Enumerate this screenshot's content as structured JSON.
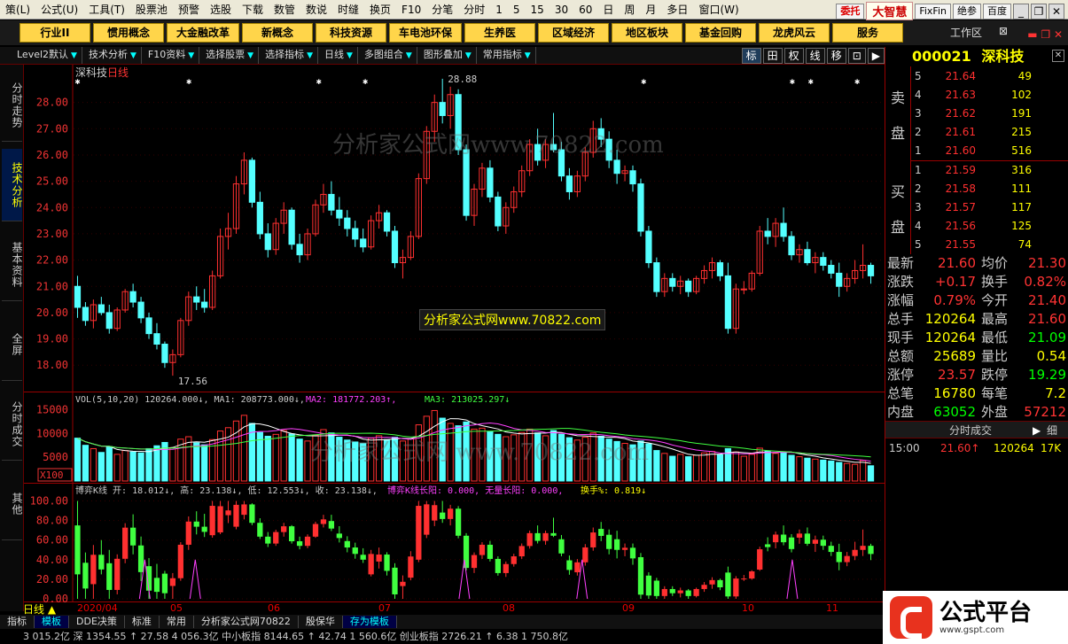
{
  "menu": [
    "策(L)",
    "公式(U)",
    "工具(T)",
    "股票池",
    "预警",
    "选股",
    "下载",
    "数管",
    "数说",
    "时缝",
    "换页",
    "F10",
    "分笔",
    "分时",
    "1",
    "5",
    "15",
    "30",
    "60",
    "日",
    "周",
    "月",
    "多日",
    "窗口(W)"
  ],
  "menu_right": {
    "btn1": "委托",
    "brand": "大智慧",
    "btn2": "FixFin",
    "btn3": "绝参",
    "btn4": "百度"
  },
  "topbar": [
    "行业II",
    "惯用概念",
    "大金融改革",
    "新概念",
    "科技资源",
    "车电池环保",
    "生养医",
    "区域经济",
    "地区板块",
    "基金回购",
    "龙虎风云",
    "服务"
  ],
  "workarea": "工作区",
  "subbar": {
    "items": [
      "Level2默认",
      "技术分析",
      "F10资料",
      "选择股票",
      "选择指标",
      "日线",
      "多图组合",
      "图形叠加",
      "常用指标"
    ],
    "right": [
      "标",
      "田",
      "权",
      "线",
      "移",
      "⊡",
      "▶"
    ]
  },
  "lefttabs": [
    "分时走势",
    "技术分析",
    "基本资料",
    "全屏",
    "分时成交",
    "其他"
  ],
  "main": {
    "title": "深科技",
    "period": "日线",
    "yaxis": [
      "28.00",
      "27.00",
      "26.00",
      "25.00",
      "24.00",
      "23.00",
      "22.00",
      "21.00",
      "20.00",
      "19.00",
      "18.00"
    ],
    "high_label": "28.88",
    "low_label": "17.56"
  },
  "vol": {
    "legend": "VOL(5,10,20)  120264.000↓, MA1: 208773.000↓,",
    "ma2": "MA2: 181772.203↑,",
    "ma3": "MA3: 213025.297↓",
    "yaxis": [
      "15000",
      "10000",
      "5000"
    ],
    "unit": "X100"
  },
  "ind": {
    "legend": "博弈K线 开: 18.012↓, 高: 23.138↓, 低: 12.553↓, 收: 23.138↓,",
    "legend2": "博弈K线长阳: 0.000, 无量长阳: 0.000,",
    "legend3": "换手%: 0.819↓",
    "yaxis": [
      "100.00",
      "80.00",
      "60.00",
      "40.00",
      "20.00",
      "0.00"
    ]
  },
  "dates": [
    "2020/04",
    "05",
    "06",
    "07",
    "08",
    "09",
    "10",
    "11"
  ],
  "kind": "日线",
  "bottomtabs": [
    "指标",
    "模板",
    "DDE决策",
    "标准",
    "常用",
    "分析家公式网70822",
    "殷保华",
    "存为模板"
  ],
  "ticker": "3 015.2亿  深  1354.55  ↑ 27.58  4 056.3亿  中小板指  8144.65  ↑ 42.74  1 560.6亿  创业板指  2726.21  ↑ 6.38  1 750.8亿",
  "stock": {
    "code": "000021",
    "name": "深科技"
  },
  "asks": [
    {
      "i": "5",
      "p": "21.64",
      "v": "49"
    },
    {
      "i": "4",
      "p": "21.63",
      "v": "102"
    },
    {
      "i": "3",
      "p": "21.62",
      "v": "191"
    },
    {
      "i": "2",
      "p": "21.61",
      "v": "215"
    },
    {
      "i": "1",
      "p": "21.60",
      "v": "516"
    }
  ],
  "bids": [
    {
      "i": "1",
      "p": "21.59",
      "v": "316"
    },
    {
      "i": "2",
      "p": "21.58",
      "v": "111"
    },
    {
      "i": "3",
      "p": "21.57",
      "v": "117"
    },
    {
      "i": "4",
      "p": "21.56",
      "v": "125"
    },
    {
      "i": "5",
      "p": "21.55",
      "v": "74"
    }
  ],
  "sides": {
    "sell1": "卖",
    "sell2": "盘",
    "buy1": "买",
    "buy2": "盘"
  },
  "stats": [
    {
      "l": "最新",
      "v": "21.60",
      "l2": "均价",
      "v2": "21.30"
    },
    {
      "l": "涨跌",
      "v": "+0.17",
      "l2": "换手",
      "v2": "0.82%"
    },
    {
      "l": "涨幅",
      "v": "0.79%",
      "l2": "今开",
      "v2": "21.40"
    },
    {
      "l": "总手",
      "v": "120264",
      "l2": "最高",
      "v2": "21.60"
    },
    {
      "l": "现手",
      "v": "120264",
      "l2": "最低",
      "v2": "21.09"
    },
    {
      "l": "总额",
      "v": "25689",
      "l2": "量比",
      "v2": "0.54"
    },
    {
      "l": "涨停",
      "v": "23.57",
      "l2": "跌停",
      "v2": "19.29"
    },
    {
      "l": "总笔",
      "v": "16780",
      "l2": "每笔",
      "v2": "7.2"
    },
    {
      "l": "内盘",
      "v": "63052",
      "l2": "外盘",
      "v2": "57212"
    }
  ],
  "fs": {
    "title": "分时成交",
    "btn": "细",
    "time": "15:00",
    "price": "21.60↑",
    "vol": "120264",
    "extra": "17K"
  },
  "watermarks": {
    "w1": "分析家公式网www.70822.com",
    "w2": "分析家公式网www.70822.com",
    "w3": "分析家公式网 www.70822.com"
  },
  "logo": {
    "t1": "公式平台",
    "t2": "www.gspt.com"
  },
  "colors": {
    "up": "#ff3030",
    "down": "#54ffff",
    "ma1": "#ffffff",
    "ma2": "#ff40ff",
    "ma3": "#40ff40"
  },
  "chart_data": {
    "type": "candlestick",
    "ylim": [
      17.3,
      29.1
    ],
    "vol_ylim": [
      0,
      16000
    ],
    "ind_ylim": [
      0,
      105
    ],
    "candles": [
      [
        21.0,
        21.4,
        19.8,
        20.2
      ],
      [
        20.2,
        20.4,
        19.5,
        19.7
      ],
      [
        19.7,
        20.5,
        19.4,
        20.3
      ],
      [
        20.3,
        20.6,
        19.9,
        20.0
      ],
      [
        20.0,
        20.3,
        19.2,
        19.4
      ],
      [
        19.4,
        20.2,
        19.3,
        20.1
      ],
      [
        20.1,
        20.9,
        20.0,
        20.8
      ],
      [
        20.8,
        21.1,
        20.2,
        20.4
      ],
      [
        20.4,
        20.6,
        19.6,
        19.8
      ],
      [
        19.8,
        20.0,
        19.0,
        19.2
      ],
      [
        19.2,
        19.6,
        18.6,
        18.8
      ],
      [
        18.8,
        18.9,
        17.9,
        18.1
      ],
      [
        18.1,
        18.6,
        17.6,
        18.4
      ],
      [
        18.4,
        19.8,
        18.3,
        19.7
      ],
      [
        19.7,
        20.8,
        19.5,
        20.6
      ],
      [
        20.6,
        21.0,
        20.1,
        20.4
      ],
      [
        20.4,
        20.9,
        20.0,
        20.2
      ],
      [
        20.2,
        21.6,
        20.1,
        21.4
      ],
      [
        21.4,
        23.2,
        21.3,
        22.9
      ],
      [
        22.9,
        23.8,
        22.4,
        23.2
      ],
      [
        23.2,
        25.2,
        23.0,
        24.9
      ],
      [
        24.9,
        26.1,
        24.5,
        25.8
      ],
      [
        25.8,
        25.9,
        24.0,
        24.2
      ],
      [
        24.2,
        24.6,
        22.8,
        23.0
      ],
      [
        23.0,
        23.4,
        22.1,
        22.4
      ],
      [
        22.4,
        23.6,
        22.2,
        23.4
      ],
      [
        23.4,
        24.2,
        23.0,
        23.9
      ],
      [
        23.9,
        24.0,
        22.4,
        22.6
      ],
      [
        22.6,
        23.0,
        21.9,
        22.2
      ],
      [
        22.2,
        23.2,
        22.0,
        23.0
      ],
      [
        23.0,
        24.3,
        22.9,
        24.1
      ],
      [
        24.1,
        24.9,
        23.8,
        24.5
      ],
      [
        24.5,
        25.0,
        23.7,
        23.9
      ],
      [
        23.9,
        24.4,
        23.3,
        23.6
      ],
      [
        23.6,
        23.9,
        22.9,
        23.2
      ],
      [
        23.2,
        23.5,
        22.5,
        22.8
      ],
      [
        22.8,
        23.2,
        22.3,
        22.5
      ],
      [
        22.5,
        23.7,
        22.4,
        23.5
      ],
      [
        23.5,
        24.1,
        23.2,
        23.8
      ],
      [
        23.8,
        23.9,
        22.9,
        23.1
      ],
      [
        23.1,
        23.3,
        21.7,
        21.9
      ],
      [
        21.9,
        22.4,
        21.3,
        22.1
      ],
      [
        22.1,
        23.1,
        22.0,
        22.9
      ],
      [
        22.9,
        25.3,
        22.8,
        25.1
      ],
      [
        25.1,
        27.1,
        24.9,
        26.9
      ],
      [
        26.9,
        28.3,
        26.5,
        28.0
      ],
      [
        28.0,
        28.9,
        27.2,
        27.5
      ],
      [
        27.5,
        28.6,
        27.0,
        28.3
      ],
      [
        28.3,
        28.5,
        26.0,
        26.2
      ],
      [
        26.2,
        26.4,
        23.5,
        23.7
      ],
      [
        23.7,
        24.9,
        23.3,
        24.7
      ],
      [
        24.7,
        25.7,
        24.4,
        25.5
      ],
      [
        25.5,
        25.8,
        24.2,
        24.4
      ],
      [
        24.4,
        24.6,
        23.1,
        23.3
      ],
      [
        23.3,
        24.2,
        23.0,
        24.0
      ],
      [
        24.0,
        24.8,
        23.8,
        24.6
      ],
      [
        24.6,
        25.6,
        24.4,
        25.4
      ],
      [
        25.4,
        26.6,
        25.2,
        26.4
      ],
      [
        26.4,
        27.0,
        25.6,
        25.8
      ],
      [
        25.8,
        26.6,
        25.5,
        26.4
      ],
      [
        26.4,
        27.6,
        26.1,
        26.2
      ],
      [
        26.2,
        26.5,
        25.0,
        25.2
      ],
      [
        25.2,
        25.5,
        24.3,
        24.6
      ],
      [
        24.6,
        25.4,
        24.4,
        25.2
      ],
      [
        25.2,
        26.3,
        25.0,
        26.1
      ],
      [
        26.1,
        27.3,
        25.9,
        27.0
      ],
      [
        27.0,
        27.4,
        26.3,
        26.6
      ],
      [
        26.6,
        26.9,
        25.5,
        25.8
      ],
      [
        25.8,
        26.2,
        24.9,
        25.3
      ],
      [
        25.3,
        25.6,
        25.0,
        25.4
      ],
      [
        25.4,
        25.6,
        24.6,
        24.9
      ],
      [
        24.9,
        25.1,
        22.9,
        23.1
      ],
      [
        23.1,
        23.3,
        21.7,
        21.9
      ],
      [
        21.9,
        22.1,
        20.6,
        20.8
      ],
      [
        20.8,
        21.5,
        20.6,
        21.3
      ],
      [
        21.3,
        21.5,
        20.8,
        21.0
      ],
      [
        21.0,
        21.4,
        20.7,
        21.2
      ],
      [
        21.2,
        21.3,
        20.6,
        20.8
      ],
      [
        20.8,
        21.4,
        20.7,
        21.3
      ],
      [
        21.3,
        21.8,
        21.1,
        21.6
      ],
      [
        21.6,
        22.1,
        21.3,
        21.9
      ],
      [
        21.9,
        22.0,
        21.2,
        21.4
      ],
      [
        21.4,
        21.9,
        19.2,
        19.4
      ],
      [
        19.4,
        21.1,
        19.2,
        20.9
      ],
      [
        20.9,
        21.2,
        20.7,
        20.9
      ],
      [
        20.9,
        21.6,
        20.8,
        21.5
      ],
      [
        21.5,
        23.3,
        21.4,
        23.1
      ],
      [
        23.1,
        23.6,
        22.6,
        22.9
      ],
      [
        22.9,
        23.6,
        22.5,
        23.4
      ],
      [
        23.4,
        24.0,
        22.7,
        22.9
      ],
      [
        22.9,
        23.1,
        22.0,
        22.2
      ],
      [
        22.2,
        22.6,
        21.9,
        22.4
      ],
      [
        22.4,
        22.7,
        21.8,
        21.9
      ],
      [
        21.9,
        22.3,
        21.5,
        22.1
      ],
      [
        22.1,
        22.3,
        21.6,
        21.8
      ],
      [
        21.8,
        22.0,
        21.3,
        21.5
      ],
      [
        21.5,
        21.9,
        20.6,
        21.0
      ],
      [
        21.0,
        21.5,
        20.8,
        21.3
      ],
      [
        21.3,
        22.0,
        21.1,
        21.6
      ],
      [
        21.6,
        22.6,
        21.3,
        21.8
      ],
      [
        21.8,
        21.9,
        21.1,
        21.4
      ]
    ],
    "volumes": [
      9000,
      7500,
      6800,
      6000,
      7200,
      5600,
      6400,
      6100,
      5900,
      6800,
      7400,
      8100,
      7000,
      8800,
      9300,
      8000,
      7600,
      8700,
      10500,
      11200,
      12600,
      13800,
      12100,
      10200,
      9400,
      9800,
      10600,
      9900,
      8800,
      8400,
      9600,
      10800,
      10100,
      9200,
      8600,
      8200,
      7900,
      9000,
      9500,
      8700,
      9200,
      8400,
      8900,
      11800,
      13600,
      14800,
      13200,
      12100,
      11600,
      12400,
      10900,
      11100,
      10400,
      9800,
      9300,
      9700,
      10200,
      10900,
      10100,
      9500,
      10600,
      9800,
      9100,
      8600,
      9200,
      10100,
      9400,
      8800,
      8300,
      7900,
      7600,
      8400,
      7800,
      6400,
      5800,
      5200,
      5600,
      5100,
      5400,
      5900,
      6200,
      5500,
      6800,
      6100,
      5200,
      5600,
      6900,
      6300,
      5800,
      6100,
      5400,
      5100,
      4800,
      4600,
      4400,
      4200,
      3900,
      3700,
      3500,
      4300,
      3200
    ]
  }
}
